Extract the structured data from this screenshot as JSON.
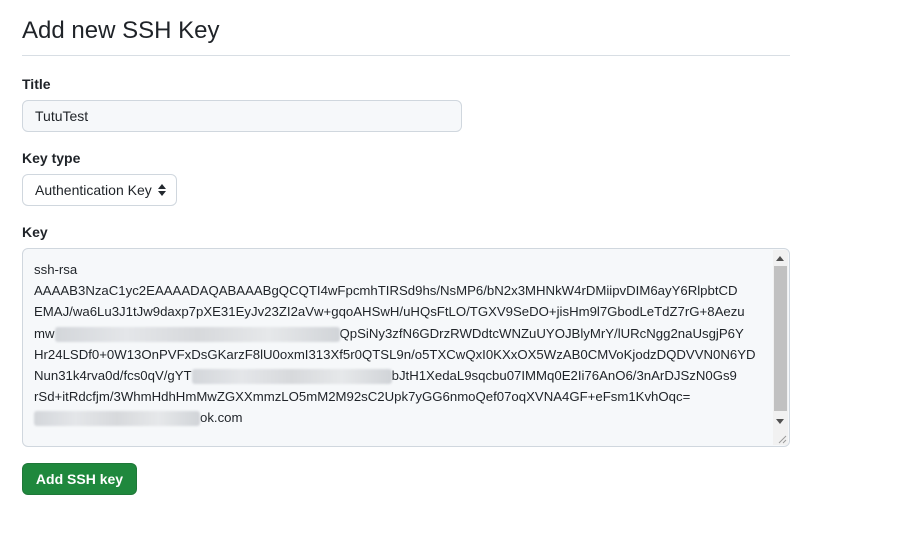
{
  "page": {
    "heading": "Add new SSH Key"
  },
  "form": {
    "title_label": "Title",
    "title_value": "TutuTest",
    "key_type_label": "Key type",
    "key_type_selected": "Authentication Key",
    "key_label": "Key",
    "key_lines": [
      {
        "pre": "ssh-rsa",
        "post": ""
      },
      {
        "pre": "AAAAB3NzaC1yc2EAAAADAQABAAABgQCQTI4wFpcmhTIRSd9hs/NsMP6/bN2x3MHNkW4rDMiipvDIM6ayY6RlpbtCD",
        "post": ""
      },
      {
        "pre": "EMAJ/wa6Lu3J1tJw9daxp7pXE31EyJv23ZI2aVw+gqoAHSwH/uHQsFtLO/TGXV9SeDO+jisHm9l7GbodLeTdZ7rG+8Aezu",
        "post": ""
      },
      {
        "pre": "mw",
        "post": "QpSiNy3zfN6GDrzRWDdtcWNZuUYOJBlyMrY/lURcNgg2naUsgjP6Y"
      },
      {
        "pre": "Hr24LSDf0+0W13OnPVFxDsGKarzF8lU0oxmI313Xf5r0QTSL9n/o5TXCwQxI0KXxOX5WzAB0CMVoKjodzDQDVVN0N6YD",
        "post": ""
      },
      {
        "pre": "Nun31k4rva0d/fcs0qV/gYT",
        "post": "bJtH1XedaL9sqcbu07IMMq0E2Ii76AnO6/3nArDJSzN0Gs9"
      },
      {
        "pre": "rSd+itRdcfjm/3WhmHdhHmMwZGXXmmzLO5mM2M92sC2Upk7yGG6nmoQef07oqXVNA4GF+eFsm1KvhOqc=",
        "post": ""
      },
      {
        "pre": "",
        "post": "ok.com"
      }
    ],
    "submit_label": "Add SSH key"
  },
  "colors": {
    "primary_button": "#1f883d",
    "input_bg": "#f6f8fa",
    "border": "#d0d7de"
  }
}
